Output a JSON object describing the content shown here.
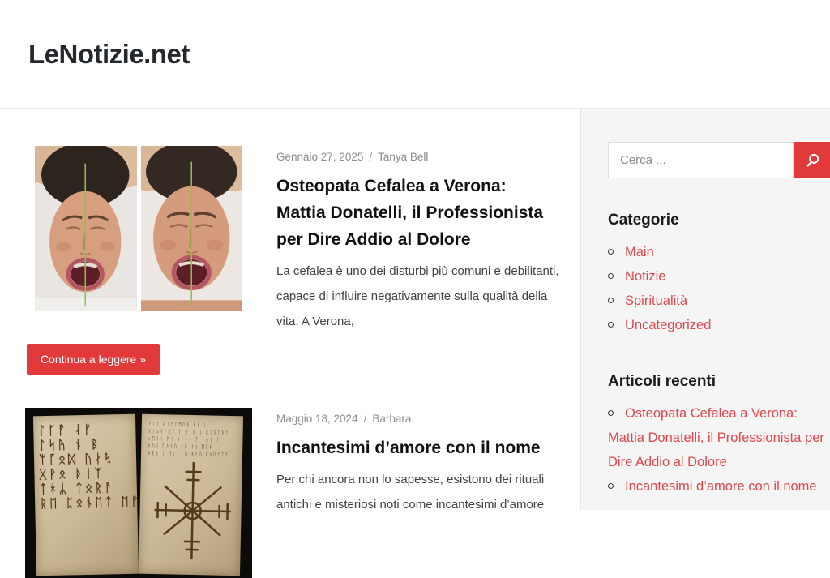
{
  "site": {
    "title": "LeNotizie.net"
  },
  "colors": {
    "accent": "#e23a3a",
    "link": "#e0474d"
  },
  "meta_separator": "/",
  "articles": [
    {
      "date": "Gennaio 27, 2025",
      "author": "Tanya Bell",
      "title": "Osteopata Cefalea a Verona: Mattia Donatelli, il Professionista per Dire Addio al Dolore",
      "excerpt": "La cefalea è uno dei disturbi più comuni e debilitanti, capace di influire negativamente sulla qualità della vita. A Verona,",
      "read_more": "Continua a leggere »"
    },
    {
      "date": "Maggio 18, 2024",
      "author": "Barbara",
      "title": "Incantesimi d’amore con il nome",
      "excerpt": "Per chi ancora non lo sapesse, esistono dei rituali antichi e misteriosi noti come incantesimi d’amore"
    }
  ],
  "sidebar": {
    "search": {
      "placeholder": "Cerca ..."
    },
    "categories": {
      "heading": "Categorie",
      "items": [
        "Main",
        "Notizie",
        "Spiritualità",
        "Uncategorized"
      ]
    },
    "recent": {
      "heading": "Articoli recenti",
      "items": [
        "Osteopata Cefalea a Verona: Mattia Donatelli, il Professionista per Dire Addio al Dolore",
        "Incantesimi d’amore con il nome"
      ]
    }
  },
  "decor_images": {
    "rune_book": {
      "left_lines": [
        "ᛚᚴᚡ ᛆᚠ",
        "ᛚᛋᚤ ᚾ ᛒ",
        "ᛘᚵᛟᛞ ᚢᛅᛪ",
        "ᚷᚹᛟ ᚦᛁᛉ",
        "ᛏᚼᛦ ᛏᛟᚱᚨ",
        "ᚱᛖ ᛈᛟᚾᛖᛏ ᛖᚠ"
      ],
      "right_lines": [
        "ᚨᛁᛉ ᚺᛁᚨᛚᛗᚢᚱ ᚼᚾ ᛁ",
        "ᚷᛁᛟᚾᚨᚷᛏ ᚨ ᛟᛁᚦ ᛁ ᛒᛁᚱᛖᚦᚨ",
        "ᛃᛖᚾᛁ ᚠᛁ ᛒᚨᚾᚾ ᚨ ᚾᛟᚾ ᛁ",
        "ᚦᚢᚾ ᛖᚦᚾᚢ ᚨᚦ ᚼᚾ ᛗᚨᚦ",
        "ᚼᚱᚾ ᛁ ᛗᛁᚾᛏᚢ ᚼᚨᚢ ᚦᚷᚢᚨᛏᚨ"
      ]
    }
  }
}
